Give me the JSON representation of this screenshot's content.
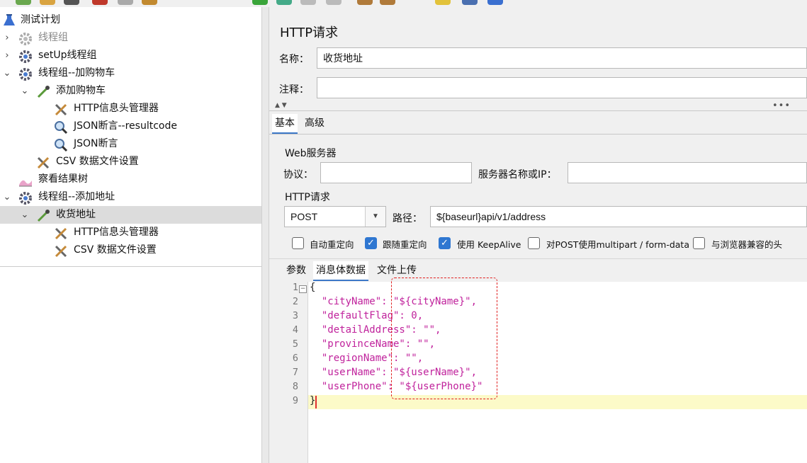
{
  "tree": {
    "items": [
      {
        "label": "测试计划",
        "icon": "flask-icon"
      },
      {
        "label": "线程组",
        "icon": "gear-icon"
      },
      {
        "label": "setUp线程组",
        "icon": "gear-icon"
      },
      {
        "label": "线程组--加购物车",
        "icon": "gear-icon"
      },
      {
        "label": "添加购物车",
        "icon": "pipette-icon"
      },
      {
        "label": "HTTP信息头管理器",
        "icon": "tools-icon"
      },
      {
        "label": "JSON断言--resultcode",
        "icon": "magnifier-icon"
      },
      {
        "label": "JSON断言",
        "icon": "magnifier-icon"
      },
      {
        "label": "CSV 数据文件设置",
        "icon": "tools-icon"
      },
      {
        "label": "察看结果树",
        "icon": "chart-icon"
      },
      {
        "label": "线程组--添加地址",
        "icon": "gear-icon"
      },
      {
        "label": "收货地址",
        "icon": "pipette-icon"
      },
      {
        "label": "HTTP信息头管理器",
        "icon": "tools-icon"
      },
      {
        "label": "CSV 数据文件设置",
        "icon": "tools-icon"
      }
    ]
  },
  "panel": {
    "title": "HTTP请求",
    "name_label": "名称：",
    "name_value": "收货地址",
    "comment_label": "注释：",
    "comment_value": ""
  },
  "tabs": {
    "basic": "基本",
    "advanced": "高级"
  },
  "web_server": {
    "group_label": "Web服务器",
    "protocol_label": "协议：",
    "protocol_value": "",
    "server_label": "服务器名称或IP：",
    "server_value": ""
  },
  "http_request": {
    "group_label": "HTTP请求",
    "method": "POST",
    "path_label": "路径：",
    "path_value": "${baseurl}api/v1/address"
  },
  "options": [
    {
      "label": "自动重定向",
      "checked": false
    },
    {
      "label": "跟随重定向",
      "checked": true
    },
    {
      "label": "使用 KeepAlive",
      "checked": true
    },
    {
      "label": "对POST使用multipart / form-data",
      "checked": false
    },
    {
      "label": "与浏览器兼容的头",
      "checked": false
    }
  ],
  "body_tabs": {
    "params": "参数",
    "body": "消息体数据",
    "upload": "文件上传"
  },
  "editor": {
    "line_numbers": [
      "1",
      "2",
      "3",
      "4",
      "5",
      "6",
      "7",
      "8",
      "9"
    ],
    "lines": [
      "{",
      "  \"cityName\": \"${cityName}\",",
      "  \"defaultFlag\": 0,",
      "  \"detailAddress\": \"\",",
      "  \"provinceName\": \"\",",
      "  \"regionName\": \"\",",
      "  \"userName\": \"${userName}\",",
      "  \"userPhone\": \"${userPhone}\"",
      "}"
    ]
  },
  "colors": {
    "accent": "#2f77d1",
    "json_key": "#c0229c",
    "highlight_box": "#e02020",
    "current_line": "#fcfac8"
  }
}
